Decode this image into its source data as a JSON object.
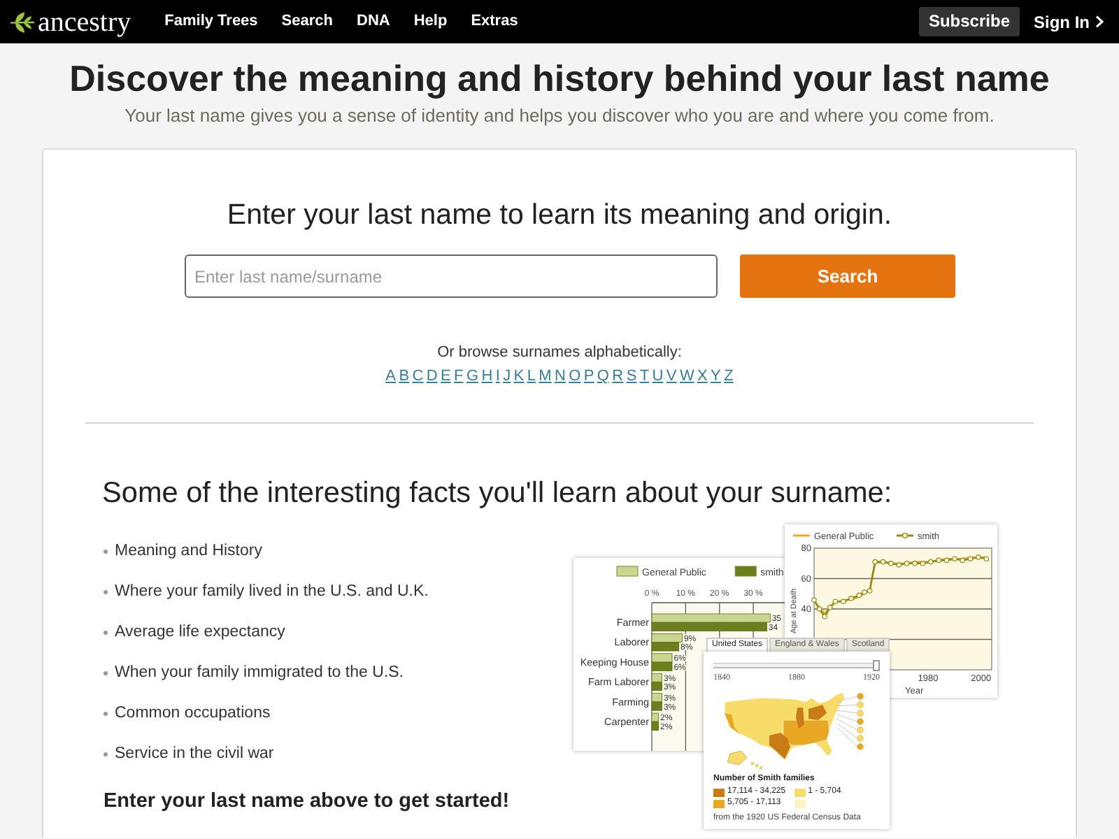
{
  "header": {
    "logo": "ancestry",
    "nav": [
      "Family Trees",
      "Search",
      "DNA",
      "Help",
      "Extras"
    ],
    "subscribe": "Subscribe",
    "sign_in": "Sign In"
  },
  "hero": {
    "title": "Discover the meaning and history behind your last name",
    "subtitle": "Your last name gives you a sense of identity and helps you discover who you are and where you come from."
  },
  "search": {
    "heading": "Enter your last name to learn its meaning and origin.",
    "placeholder": "Enter last name/surname",
    "button": "Search",
    "browse_label": "Or browse surnames alphabetically:",
    "letters": [
      "A",
      "B",
      "C",
      "D",
      "E",
      "F",
      "G",
      "H",
      "I",
      "J",
      "K",
      "L",
      "M",
      "N",
      "O",
      "P",
      "Q",
      "R",
      "S",
      "T",
      "U",
      "V",
      "W",
      "X",
      "Y",
      "Z"
    ]
  },
  "facts": {
    "heading": "Some of the interesting facts you'll learn about your surname:",
    "items": [
      "Meaning and History",
      "Where your family lived in the U.S. and U.K.",
      "Average life expectancy",
      "When your family immigrated to the U.S.",
      "Common occupations",
      "Service in the civil war"
    ],
    "call_to_action": "Enter your last name above to get started!"
  },
  "illustration": {
    "bar_chart": {
      "chart_data": {
        "type": "bar",
        "orientation": "horizontal",
        "legend": "top",
        "grid": true,
        "categories": [
          "Farmer",
          "Laborer",
          "Keeping House",
          "Farm Laborer",
          "Farming",
          "Carpenter"
        ],
        "series": [
          {
            "name": "General Public",
            "color": "#c9d68f",
            "values": [
              35,
              9,
              6,
              3,
              3,
              2
            ]
          },
          {
            "name": "smith",
            "color": "#6b7f1c",
            "values": [
              34,
              8,
              6,
              3,
              3,
              2
            ]
          }
        ],
        "xlim": [
          0,
          43
        ],
        "xticks": [
          {
            "value": 0,
            "label": "0 %"
          },
          {
            "value": 10,
            "label": "10 %"
          },
          {
            "value": 20,
            "label": "20 %"
          },
          {
            "value": 30,
            "label": "30 %"
          }
        ],
        "value_labels": [
          [
            "35",
            "9%",
            "6%",
            "3%",
            "3%",
            "2%"
          ],
          [
            "34",
            "8%",
            "6%",
            "3%",
            "3%",
            "2%"
          ]
        ]
      }
    },
    "line_chart": {
      "chart_data": {
        "type": "line",
        "legend": "top",
        "grid": true,
        "xlabel": "Year",
        "ylabel": "Age at Death",
        "x": [
          1937,
          1939,
          1941,
          1943,
          1945,
          1948,
          1951,
          1954,
          1956,
          1958,
          1960,
          1963,
          1966,
          1969,
          1972,
          1975,
          1978,
          1981,
          1984,
          1987,
          1990,
          1993,
          1996,
          1999,
          2002
        ],
        "series": [
          {
            "name": "General Public",
            "color": "#f0a92e",
            "values": [
              45,
              41,
              37,
              42,
              44,
              46,
              46,
              48,
              50,
              53,
              70,
              71,
              70,
              70,
              70,
              71,
              71,
              71,
              72,
              73,
              73,
              73,
              74,
              74,
              74
            ]
          },
          {
            "name": "smith",
            "color": "#8c8c1c",
            "marker": "circle",
            "values": [
              46,
              40,
              35,
              41,
              45,
              45,
              47,
              49,
              51,
              52,
              71,
              71,
              70,
              69,
              70,
              70,
              70,
              71,
              72,
              72,
              73,
              72,
              73,
              74,
              73
            ]
          }
        ],
        "xlim": [
          1937,
          2004
        ],
        "ylim": [
          0,
          80
        ],
        "xticks": [
          1980,
          2000
        ],
        "yticks": [
          40,
          60,
          80
        ]
      }
    },
    "map_panel": {
      "tabs": [
        {
          "label": "United States",
          "selected": true
        },
        {
          "label": "England & Wales",
          "selected": false
        },
        {
          "label": "Scotland",
          "selected": false
        }
      ],
      "slider": {
        "labels": [
          "1840",
          "1880",
          "1920"
        ],
        "level": 1
      },
      "legend_title": "Number of Smith families",
      "legend": [
        {
          "label": "17,114 - 34,225",
          "color": "#c97c16"
        },
        {
          "label": "1 - 5,704",
          "color": "#f7dc6a"
        },
        {
          "label": "5,705 - 17,113",
          "color": "#e9a823"
        },
        {
          "color": "#fdf4c4"
        }
      ],
      "source": "from the 1920 US Federal Census Data"
    }
  }
}
